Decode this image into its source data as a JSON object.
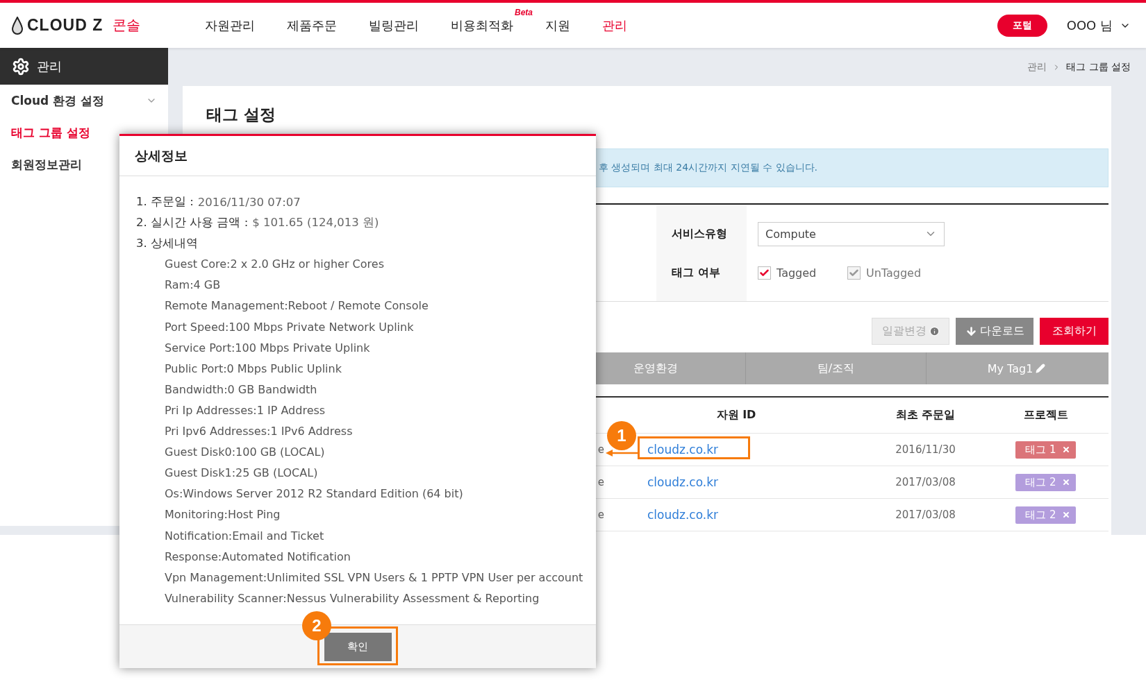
{
  "header": {
    "logo": {
      "brand": "CLOUD Z",
      "product": "콘솔"
    },
    "nav": [
      {
        "label": "자원관리",
        "selected": false
      },
      {
        "label": "제품주문",
        "selected": false
      },
      {
        "label": "빌링관리",
        "selected": false
      },
      {
        "label": "비용최적화",
        "selected": false,
        "badge": "Beta"
      },
      {
        "label": "지원",
        "selected": false
      },
      {
        "label": "관리",
        "selected": true
      }
    ],
    "portal_button": "포털",
    "user": "OOO 님"
  },
  "sidebar": {
    "title": "관리",
    "items": [
      {
        "label": "Cloud 환경 설정",
        "selected": false,
        "expandable": true
      },
      {
        "label": "태그 그룹 설정",
        "selected": true
      },
      {
        "label": "회원정보관리",
        "selected": false
      }
    ]
  },
  "breadcrumb": [
    "관리",
    "태그 그룹 설정"
  ],
  "page": {
    "title": "태그 설정",
    "notice": "후 생성되며 최대 24시간까지 지연될 수 있습니다.",
    "filters": {
      "service_type": {
        "label": "서비스유형",
        "value": "Compute"
      },
      "tag_status": {
        "label": "태그 여부",
        "options": [
          {
            "label": "Tagged",
            "checked": true,
            "disabled": false
          },
          {
            "label": "UnTagged",
            "checked": true,
            "disabled": true
          }
        ]
      }
    },
    "buttons": [
      {
        "label": "일괄변경",
        "kind": "bulk",
        "disabled": true
      },
      {
        "label": "다운로드",
        "kind": "download",
        "disabled": false
      },
      {
        "label": "조회하기",
        "kind": "search",
        "disabled": false
      }
    ],
    "tag_columns": [
      "운영환경",
      "팀/조직",
      "My Tag1"
    ],
    "table": {
      "columns": [
        "자원 ID",
        "최초 주문일",
        "프로젝트"
      ],
      "rows": [
        {
          "column_1": "e",
          "resource_id": "cloudz.co.kr",
          "first_order_date": "2016/11/30",
          "project": {
            "label": "태그 1",
            "color": "#db7479"
          }
        },
        {
          "column_1": "e",
          "resource_id": "cloudz.co.kr",
          "first_order_date": "2017/03/08",
          "project": {
            "label": "태그 2",
            "color": "#b39ddd"
          }
        },
        {
          "column_1": "e",
          "resource_id": "cloudz.co.kr",
          "first_order_date": "2017/03/08",
          "project": {
            "label": "태그 2",
            "color": "#b39ddd"
          }
        }
      ]
    }
  },
  "modal": {
    "title": "상세정보",
    "summary": [
      {
        "label": "1. 주문일 :",
        "value": "2016/11/30 07:07"
      },
      {
        "label": "2. 실시간 사용 금액 :",
        "value": "$ 101.65 (124,013 원)"
      },
      {
        "label": "3. 상세내역"
      }
    ],
    "details": [
      "Guest Core:2 x 2.0 GHz or higher Cores",
      "Ram:4 GB",
      "Remote Management:Reboot / Remote Console",
      "Port Speed:100 Mbps Private Network Uplink",
      "Service Port:100 Mbps Private Uplink",
      "Public Port:0 Mbps Public Uplink",
      "Bandwidth:0 GB Bandwidth",
      "Pri Ip Addresses:1 IP Address",
      "Pri Ipv6 Addresses:1 IPv6 Address",
      "Guest Disk0:100 GB (LOCAL)",
      "Guest Disk1:25 GB (LOCAL)",
      "Os:Windows Server 2012 R2 Standard Edition (64 bit)",
      "Monitoring:Host Ping",
      "Notification:Email and Ticket",
      "Response:Automated Notification",
      "Vpn Management:Unlimited SSL VPN Users & 1 PPTP VPN User per account",
      "Vulnerability Scanner:Nessus Vulnerability Assessment & Reporting"
    ],
    "confirm_button": "확인"
  },
  "callouts": [
    "1",
    "2"
  ]
}
